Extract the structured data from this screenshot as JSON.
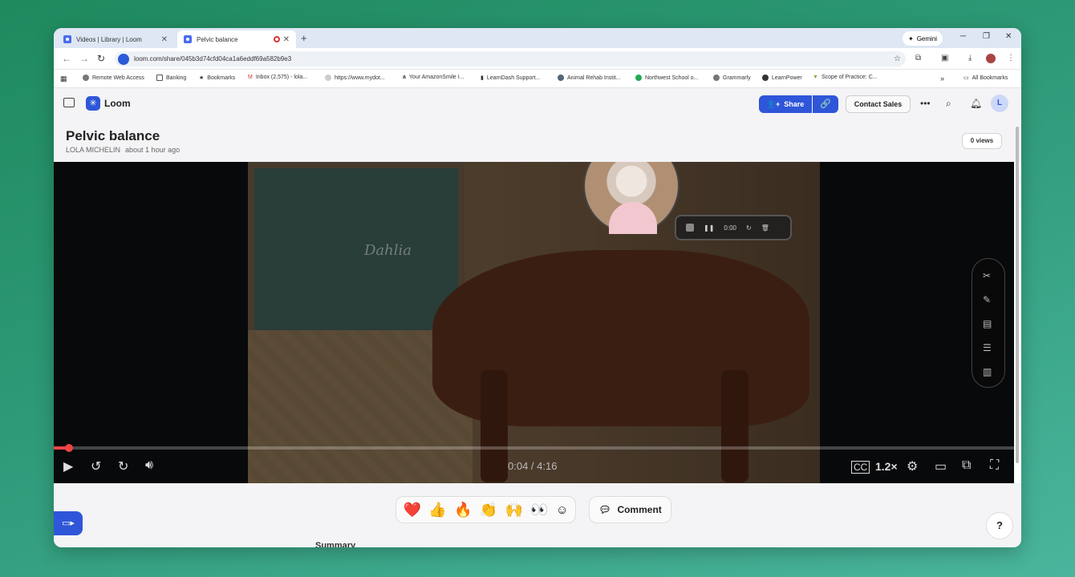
{
  "browser": {
    "tabs": [
      {
        "label": "Videos | Library | Loom"
      },
      {
        "label": "Pelvic balance"
      }
    ],
    "gemini_label": "Gemini",
    "url": "loom.com/share/045b3d74cfd04ca1a6eddf69a582b9e3",
    "bookmarks": [
      "Remote Web Access",
      "Banking",
      "Bookmarks",
      "Inbox (2,575) - lola...",
      "https://www.mydot...",
      "Your AmazonSmile I...",
      "LearnDash Support...",
      "Animal Rehab Instit...",
      "Northwest School o...",
      "Grammarly",
      "LearnPower",
      "Scope of Practice: C..."
    ],
    "all_bookmarks": "All Bookmarks"
  },
  "loom": {
    "brand": "Loom",
    "share_label": "Share",
    "contact_sales": "Contact Sales",
    "avatar_initial": "L",
    "title": "Pelvic balance",
    "author": "LOLA MICHELIN",
    "posted": "about 1 hour ago",
    "views": "0 views",
    "video_text": "Dahlia",
    "recorder_time": "0:00",
    "time_display": "0:04 / 4:16",
    "progress_fraction": 0.016,
    "speed": "1.2×",
    "comment_label": "Comment",
    "help_label": "?",
    "summary_label": "Summary",
    "reactions": [
      "❤️",
      "👍",
      "🔥",
      "👏",
      "🙌",
      "👀"
    ],
    "accent_color": "#2f56d8"
  }
}
